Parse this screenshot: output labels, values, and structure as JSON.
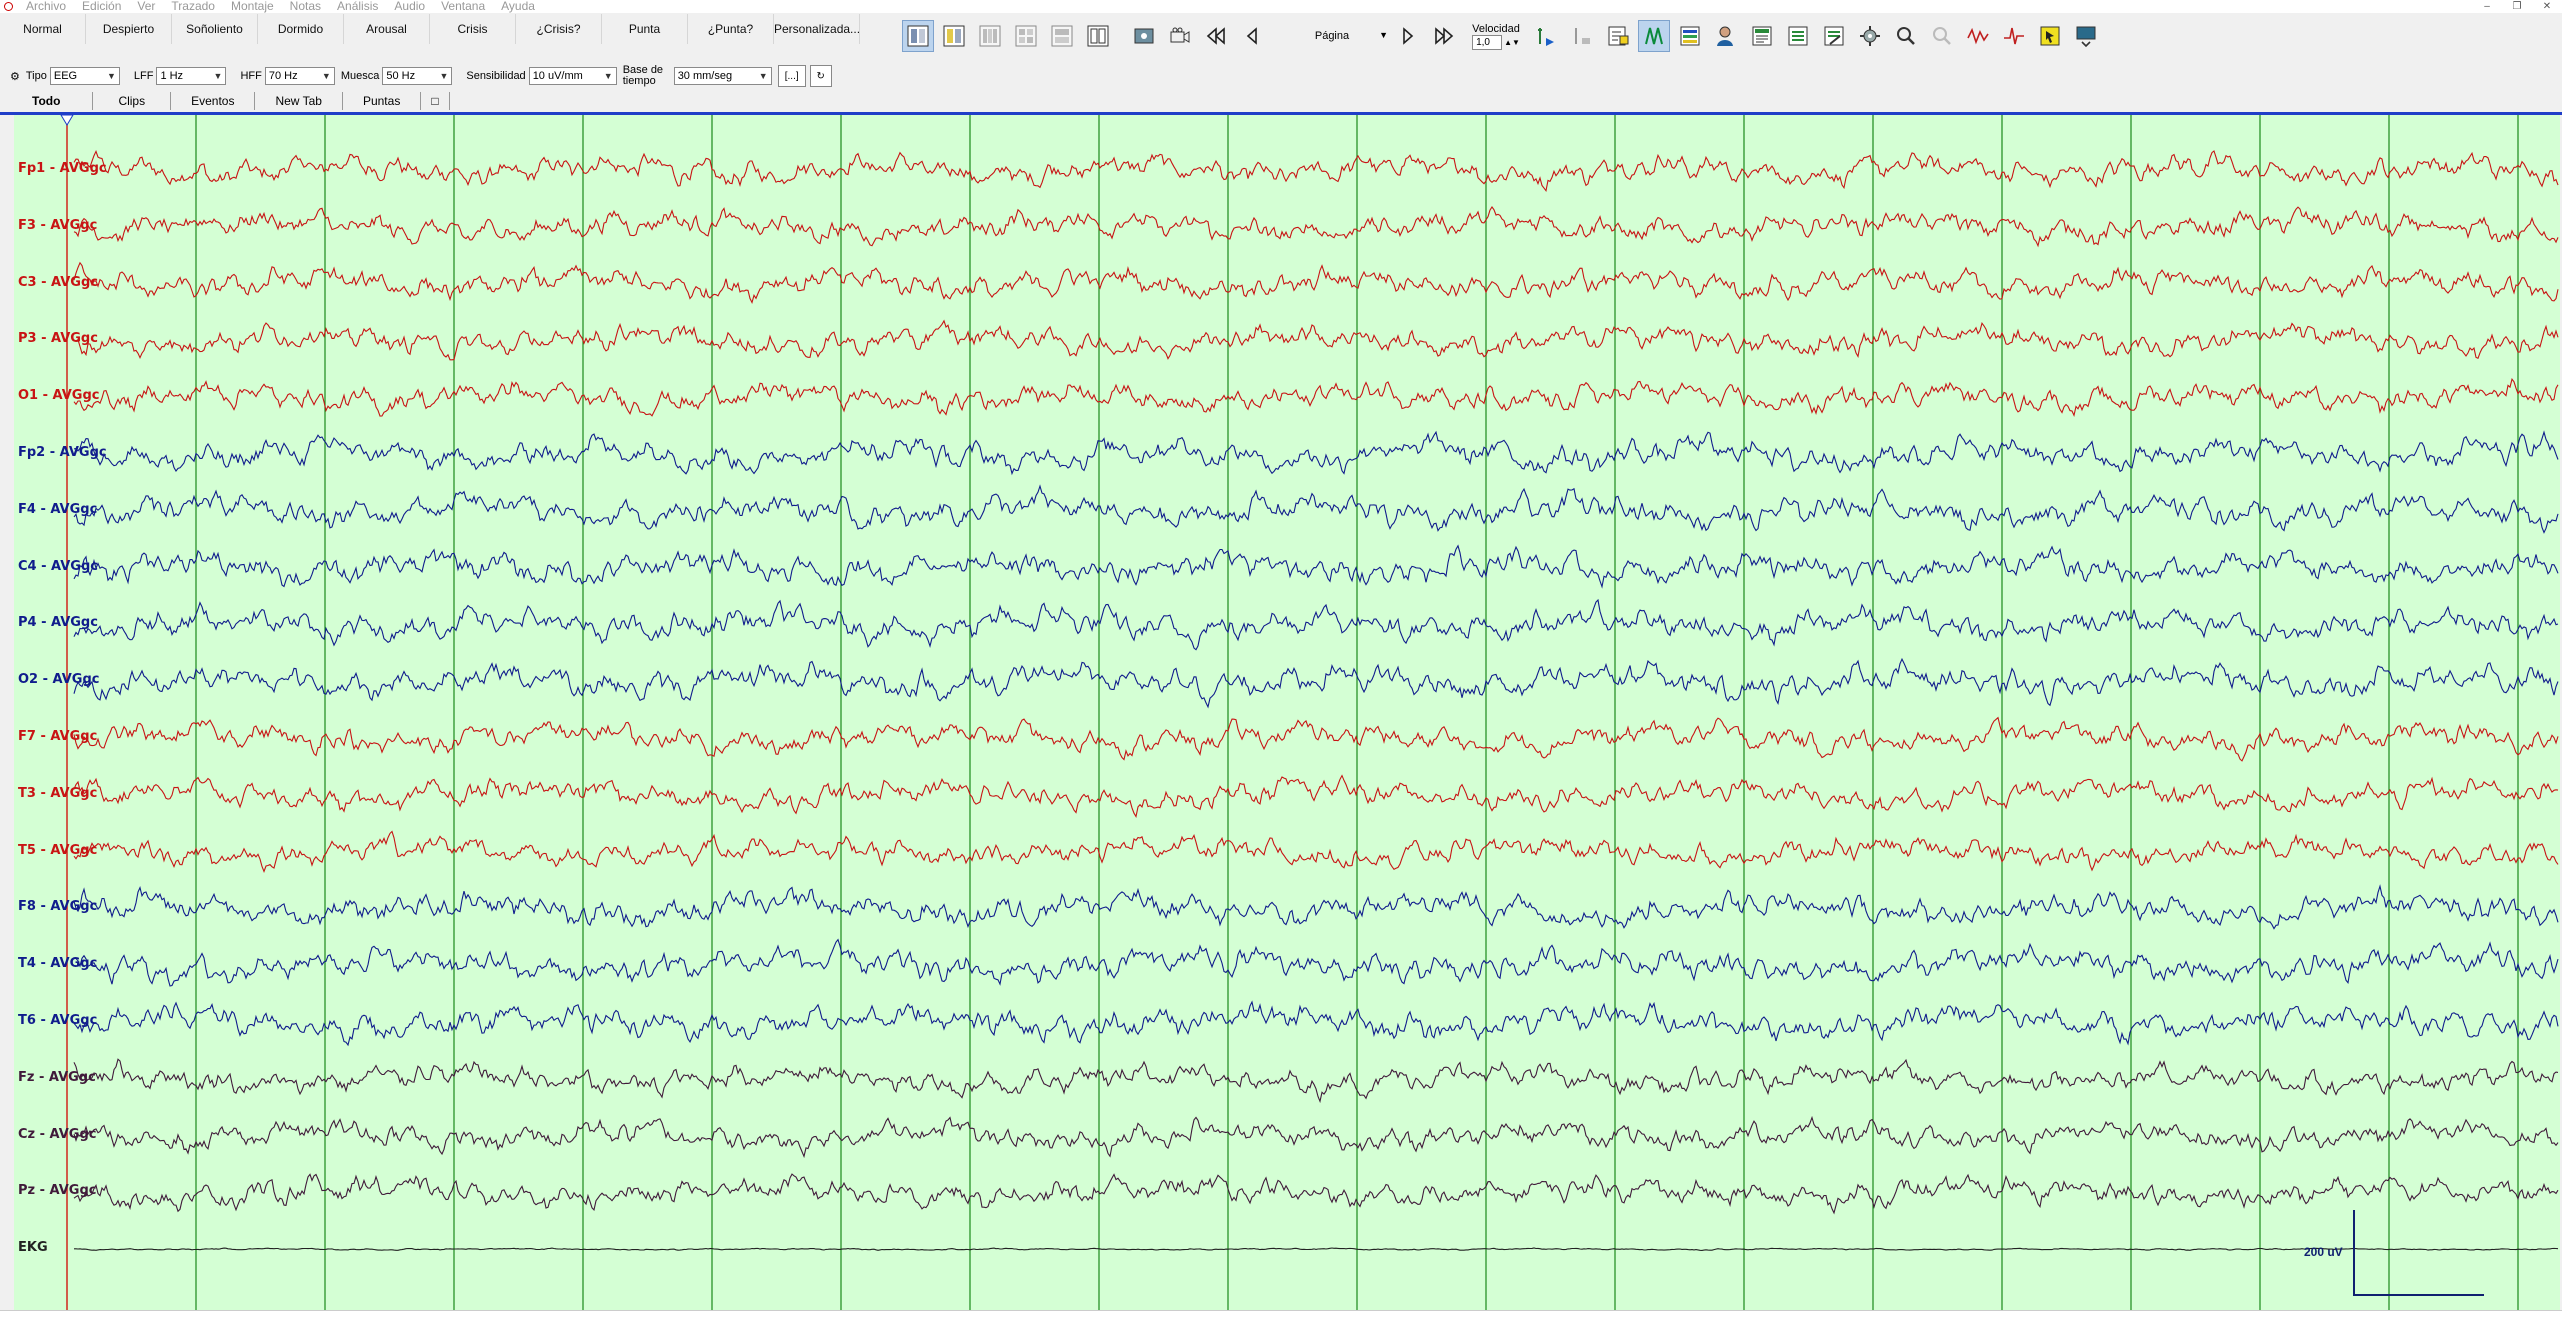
{
  "menu": [
    "Archivo",
    "Edición",
    "Ver",
    "Trazado",
    "Montaje",
    "Notas",
    "Análisis",
    "Audio",
    "Ventana",
    "Ayuda"
  ],
  "presets": [
    "Normal",
    "Despierto",
    "Soñoliento",
    "Dormido",
    "Arousal",
    "Crisis",
    "¿Crisis?",
    "Punta",
    "¿Punta?",
    "Personalizada..."
  ],
  "toolbar": {
    "page_label": "Página",
    "velocidad_label": "Velocidad",
    "velocidad_value": "1,0"
  },
  "settings": {
    "tipo_label": "Tipo",
    "tipo_value": "EEG",
    "lff_label": "LFF",
    "lff_value": "1 Hz",
    "hff_label": "HFF",
    "hff_value": "70 Hz",
    "muesca_label": "Muesca",
    "muesca_value": "50 Hz",
    "sens_label": "Sensibilidad",
    "sens_value": "10 uV/mm",
    "base_label": "Base de tiempo",
    "base_value": "30 mm/seg",
    "bracket_btn": "[...]"
  },
  "tabs": [
    "Todo",
    "Clips",
    "Eventos",
    "New Tab",
    "Puntas"
  ],
  "scale": {
    "label": "200 uV"
  },
  "channels": [
    {
      "name": "Fp1 - AVGgc",
      "color": "#c81414"
    },
    {
      "name": "F3 - AVGgc",
      "color": "#c81414"
    },
    {
      "name": "C3 - AVGgc",
      "color": "#c81414"
    },
    {
      "name": "P3 - AVGgc",
      "color": "#c81414"
    },
    {
      "name": "O1 - AVGgc",
      "color": "#c81414"
    },
    {
      "name": "Fp2 - AVGgc",
      "color": "#101c8c"
    },
    {
      "name": "F4 - AVGgc",
      "color": "#101c8c"
    },
    {
      "name": "C4 - AVGgc",
      "color": "#101c8c"
    },
    {
      "name": "P4 - AVGgc",
      "color": "#101c8c"
    },
    {
      "name": "O2 - AVGgc",
      "color": "#101c8c"
    },
    {
      "name": "F7 - AVGgc",
      "color": "#c81414"
    },
    {
      "name": "T3 - AVGgc",
      "color": "#c81414"
    },
    {
      "name": "T5 - AVGgc",
      "color": "#c81414"
    },
    {
      "name": "F8 - AVGgc",
      "color": "#101c8c"
    },
    {
      "name": "T4 - AVGgc",
      "color": "#101c8c"
    },
    {
      "name": "T6 - AVGgc",
      "color": "#101c8c"
    },
    {
      "name": "Fz - AVGgc",
      "color": "#401a3a"
    },
    {
      "name": "Cz - AVGgc",
      "color": "#401a3a"
    },
    {
      "name": "Pz - AVGgc",
      "color": "#401a3a"
    },
    {
      "name": "EKG",
      "color": "#222222"
    }
  ],
  "colors": {
    "background": "#d4ffd4",
    "gridline": "#1a8a1a",
    "cursor": "#e02020",
    "scalebar": "#102070"
  }
}
